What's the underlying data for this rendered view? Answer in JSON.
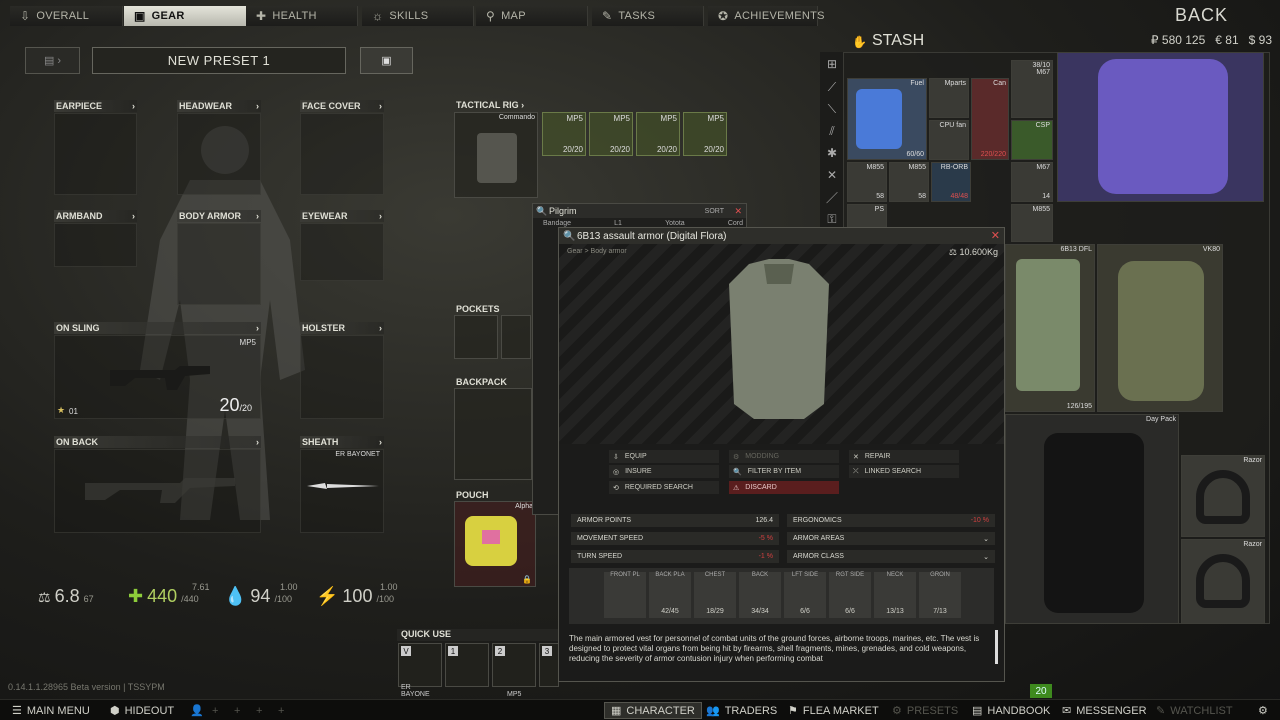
{
  "tabs": [
    {
      "label": "OVERALL",
      "icon": "arrow-down-icon"
    },
    {
      "label": "GEAR",
      "icon": "backpack-icon"
    },
    {
      "label": "HEALTH",
      "icon": "health-icon"
    },
    {
      "label": "SKILLS",
      "icon": "skills-icon"
    },
    {
      "label": "MAP",
      "icon": "map-pin-icon"
    },
    {
      "label": "TASKS",
      "icon": "tasks-icon"
    },
    {
      "label": "ACHIEVEMENTS",
      "icon": "achievement-icon"
    }
  ],
  "back_label": "BACK",
  "preset": {
    "name": "NEW PRESET 1"
  },
  "slots": {
    "earpiece": "EARPIECE",
    "headwear": "HEADWEAR",
    "face_cover": "FACE COVER",
    "armband": "ARMBAND",
    "body_armor": "BODY ARMOR",
    "eyewear": "EYEWEAR",
    "on_sling": "ON SLING",
    "holster": "HOLSTER",
    "on_back": "ON BACK",
    "sheath": "SHEATH",
    "tactical_rig": "TACTICAL RIG",
    "pockets": "POCKETS",
    "backpack": "BACKPACK",
    "pouch": "POUCH"
  },
  "sling_weapon": {
    "name": "MP5",
    "ammo": "20",
    "capacity": "/20",
    "level": "01"
  },
  "sheath_item": "ER BAYONET",
  "rig": {
    "name": "Commando",
    "mags": [
      {
        "name": "MP5",
        "ammo": "20/20"
      },
      {
        "name": "MP5",
        "ammo": "20/20"
      },
      {
        "name": "MP5",
        "ammo": "20/20"
      },
      {
        "name": "MP5",
        "ammo": "20/20"
      }
    ]
  },
  "pouch_item": "Alpha",
  "stats": {
    "weight": "6.8",
    "weight_max": "67",
    "health": "440",
    "health_max": "/440",
    "health_regen": "7.61",
    "hydration": "94",
    "hydration_max": "/100",
    "hydration_delta": "1.00",
    "energy": "100",
    "energy_max": "/100",
    "energy_delta": "1.00"
  },
  "quick_use": {
    "title": "QUICK USE",
    "slots": [
      {
        "key": "V",
        "label": "ER BAYONE"
      },
      {
        "key": "1",
        "label": ""
      },
      {
        "key": "2",
        "label": "MP5"
      },
      {
        "key": "3",
        "label": ""
      }
    ]
  },
  "version": "0.14.1.1.28965 Beta version | TSSYPM",
  "stash": {
    "title": "STASH",
    "roubles": "₽ 580 125",
    "euros": "€ 81",
    "dollars": "$ 93",
    "items": [
      {
        "label": "Fuel",
        "count": "60/60"
      },
      {
        "label": "Mparts",
        "count": ""
      },
      {
        "label": "Can",
        "count": "220/220"
      },
      {
        "label": "M67",
        "count": "38/10"
      },
      {
        "label": "CPU fan",
        "count": ""
      },
      {
        "label": "CSP",
        "count": ""
      },
      {
        "label": "M855",
        "count": "58"
      },
      {
        "label": "M855",
        "count": "58"
      },
      {
        "label": "RB-ORB",
        "count": "48/48"
      },
      {
        "label": "M67",
        "count": "14"
      },
      {
        "label": "PS",
        "count": ""
      },
      {
        "label": "M855",
        "count": ""
      },
      {
        "label": "6B13 DFL",
        "count": "126/195"
      },
      {
        "label": "VK80",
        "count": ""
      },
      {
        "label": "Day Pack",
        "count": ""
      },
      {
        "label": "Razor",
        "count": ""
      },
      {
        "label": "Razor",
        "count": ""
      }
    ]
  },
  "pilgrim": {
    "title": "Pilgrim",
    "sort_label": "SORT",
    "row": [
      "Bandage",
      "L1",
      "Yotota",
      "Cord"
    ]
  },
  "inspect": {
    "title": "6B13 assault armor (Digital Flora)",
    "breadcrumb": "Gear > Body armor",
    "weight": "10.600Kg",
    "actions": [
      {
        "label": "EQUIP",
        "icon": "equip-icon",
        "state": "normal"
      },
      {
        "label": "MODDING",
        "icon": "modding-icon",
        "state": "disabled"
      },
      {
        "label": "REPAIR",
        "icon": "repair-icon",
        "state": "normal"
      },
      {
        "label": "INSURE",
        "icon": "insure-icon",
        "state": "normal"
      },
      {
        "label": "FILTER BY ITEM",
        "icon": "filter-icon",
        "state": "normal"
      },
      {
        "label": "LINKED SEARCH",
        "icon": "linked-search-icon",
        "state": "normal"
      },
      {
        "label": "REQUIRED SEARCH",
        "icon": "required-search-icon",
        "state": "normal"
      },
      {
        "label": "DISCARD",
        "icon": "discard-icon",
        "state": "danger"
      }
    ],
    "props": [
      {
        "label": "ARMOR POINTS",
        "value": "126.4",
        "red": false
      },
      {
        "label": "ERGONOMICS",
        "value": "-10 %",
        "red": true
      },
      {
        "label": "MOVEMENT SPEED",
        "value": "-5 %",
        "red": true
      },
      {
        "label": "ARMOR AREAS",
        "value": "",
        "red": false
      },
      {
        "label": "TURN SPEED",
        "value": "-1 %",
        "red": true
      },
      {
        "label": "ARMOR CLASS",
        "value": "",
        "red": false
      }
    ],
    "zones": [
      {
        "label": "FRONT PL",
        "dur": ""
      },
      {
        "label": "BACK PLA",
        "dur": "42/45"
      },
      {
        "label": "CHEST",
        "dur": "18/29"
      },
      {
        "label": "BACK",
        "dur": "34/34"
      },
      {
        "label": "LFT SIDE",
        "dur": "6/6"
      },
      {
        "label": "RGT SIDE",
        "dur": "6/6"
      },
      {
        "label": "NECK",
        "dur": "13/13"
      },
      {
        "label": "GROIN",
        "dur": "7/13"
      }
    ],
    "description": "The main armored vest for personnel of combat units of the ground forces, airborne troops, marines, etc. The vest is designed to protect vital organs from being hit by firearms, shell fragments, mines, grenades, and cold weapons, reducing the severity of armor contusion injury when performing combat"
  },
  "bottom": {
    "main_menu": "MAIN MENU",
    "hideout": "HIDEOUT",
    "character": "CHARACTER",
    "traders": "TRADERS",
    "flea_market": "FLEA MARKET",
    "presets": "PRESETS",
    "handbook": "HANDBOOK",
    "messenger": "MESSENGER",
    "watchlist": "WATCHLIST",
    "level": "20"
  }
}
